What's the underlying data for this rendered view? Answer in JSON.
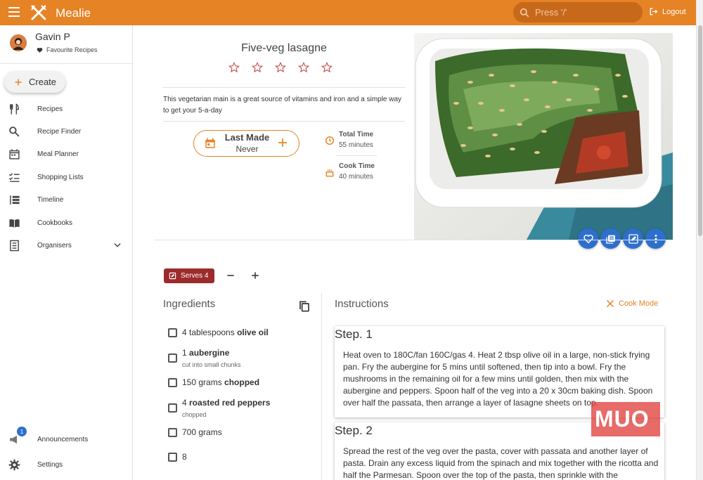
{
  "header": {
    "brand": "Mealie",
    "search_placeholder": "Press '/'",
    "logout_label": "Logout",
    "accent_color": "#e58325"
  },
  "sidebar": {
    "user_name": "Gavin P",
    "favourites_label": "Favourite Recipes",
    "create_label": "Create",
    "items": [
      {
        "label": "Recipes",
        "icon": "fork-knife-icon"
      },
      {
        "label": "Recipe Finder",
        "icon": "search-icon"
      },
      {
        "label": "Meal Planner",
        "icon": "calendar-icon"
      },
      {
        "label": "Shopping Lists",
        "icon": "checklist-icon"
      },
      {
        "label": "Timeline",
        "icon": "timeline-icon"
      },
      {
        "label": "Cookbooks",
        "icon": "book-icon"
      },
      {
        "label": "Organisers",
        "icon": "folder-icon"
      }
    ],
    "bottom_items": [
      {
        "label": "Announcements",
        "icon": "megaphone-icon",
        "badge": "1"
      },
      {
        "label": "Settings",
        "icon": "gear-icon"
      }
    ]
  },
  "recipe": {
    "title": "Five-veg lasagne",
    "rating_stars": 0,
    "rating_max": 5,
    "description": "This vegetarian main is a great source of vitamins and iron and a simple way to get your 5-a-day",
    "last_made_label": "Last Made",
    "last_made_value": "Never",
    "total_time_label": "Total Time",
    "total_time_value": "55 minutes",
    "cook_time_label": "Cook Time",
    "cook_time_value": "40 minutes",
    "serves_label": "Serves 4",
    "actions": [
      "heart-icon",
      "add-to-list-icon",
      "edit-icon",
      "more-icon"
    ]
  },
  "ingredients": {
    "title": "Ingredients",
    "items": [
      {
        "qty": "4 tablespoons ",
        "name": "olive oil",
        "note": ""
      },
      {
        "qty": "1 ",
        "name": "aubergine",
        "note": "cut into small chunks"
      },
      {
        "qty": "150 grams ",
        "name": "chopped",
        "note": ""
      },
      {
        "qty": "4 ",
        "name": "roasted red peppers",
        "note": "chopped"
      },
      {
        "qty": "700 grams",
        "name": "",
        "note": ""
      },
      {
        "qty": "8",
        "name": "",
        "note": ""
      }
    ]
  },
  "instructions": {
    "title": "Instructions",
    "cook_mode_label": "Cook Mode",
    "steps": [
      {
        "heading": "Step. 1",
        "text": "Heat oven to 180C/fan 160C/gas 4. Heat 2 tbsp olive oil in a large, non-stick frying pan. Fry the aubergine for 5 mins until softened, then tip into a bowl. Fry the mushrooms in the remaining oil for a few mins until golden, then mix with the aubergine and peppers. Spoon half of the veg into a 20 x 30cm baking dish. Spoon over half the passata, then arrange a layer of lasagne sheets on top."
      },
      {
        "heading": "Step. 2",
        "text": "Spread the rest of the veg over the pasta, cover with passata and another layer of pasta. Drain any excess liquid from the spinach and mix together with the ricotta and half the Parmesan. Spoon over the top of the pasta, then sprinkle with the"
      }
    ]
  },
  "watermark": "MUO"
}
